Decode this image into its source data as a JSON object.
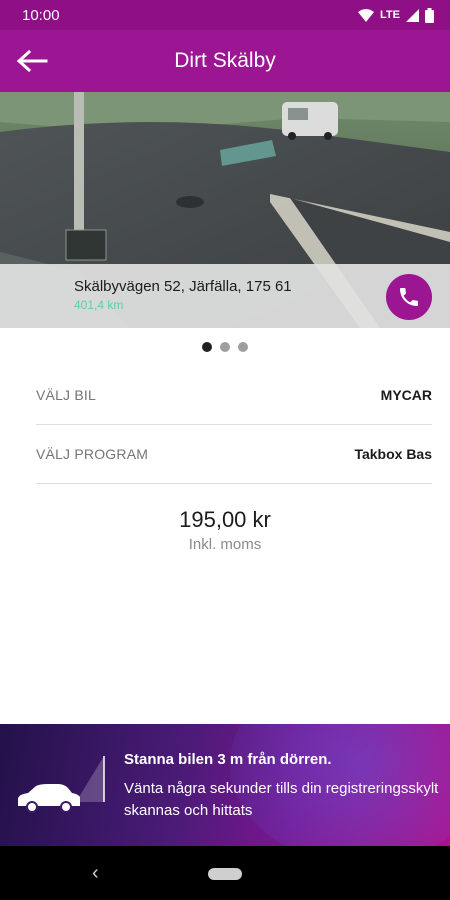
{
  "status_bar": {
    "time": "10:00",
    "network": "LTE"
  },
  "header": {
    "title": "Dirt Skälby",
    "back_icon": "arrow-left-icon"
  },
  "location": {
    "address": "Skälbyvägen 52, Järfälla, 175 61",
    "distance": "401,4 km",
    "call_icon": "phone-icon"
  },
  "carousel": {
    "page_count": 3,
    "active_index": 0
  },
  "options": [
    {
      "label": "VÄLJ BIL",
      "value": "MYCAR"
    },
    {
      "label": "VÄLJ PROGRAM",
      "value": "Takbox Bas"
    }
  ],
  "price": {
    "amount": "195,00 kr",
    "note": "Inkl. moms"
  },
  "banner": {
    "title": "Stanna bilen 3 m från dörren.",
    "text": "Vänta några sekunder tills din registreringsskylt skannas och hittats",
    "icon": "car-scan-icon"
  },
  "colors": {
    "brand": "#9c1592",
    "distance": "#5ad0a6"
  }
}
